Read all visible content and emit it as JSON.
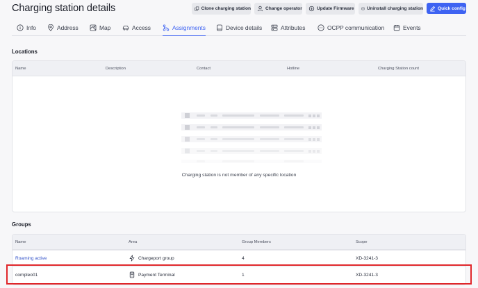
{
  "header": {
    "title": "Charging station details",
    "actions": {
      "clone": "Clone charging station",
      "change_operator": "Change operator",
      "update_firmware": "Update Firmware",
      "uninstall": "Uninstall charging station",
      "quick_config": "Quick config"
    }
  },
  "tabs": {
    "info": "Info",
    "address": "Address",
    "map": "Map",
    "access": "Access",
    "assignments": "Assignments",
    "device_details": "Device details",
    "attributes": "Attributes",
    "ocpp": "OCPP communication",
    "events": "Events",
    "active": "Assignments"
  },
  "locations": {
    "title": "Locations",
    "columns": {
      "name": "Name",
      "description": "Description",
      "contact": "Contact",
      "hotline": "Hotline",
      "count": "Charging Station count"
    },
    "empty_message": "Charging station is not member of any specific location"
  },
  "groups": {
    "title": "Groups",
    "columns": {
      "name": "Name",
      "area": "Area",
      "members": "Group Members",
      "scope": "Scope"
    },
    "rows": [
      {
        "name": "Roaming active",
        "area": "Chargeport group",
        "area_icon": "lightning-icon",
        "members": "4",
        "scope": "XD-3241-3"
      },
      {
        "name": "compleo01",
        "area": "Payment Terminal",
        "area_icon": "terminal-icon",
        "members": "1",
        "scope": "XD-3241-3"
      }
    ]
  },
  "colors": {
    "accent": "#3e63f2",
    "highlight": "#e0262a"
  }
}
